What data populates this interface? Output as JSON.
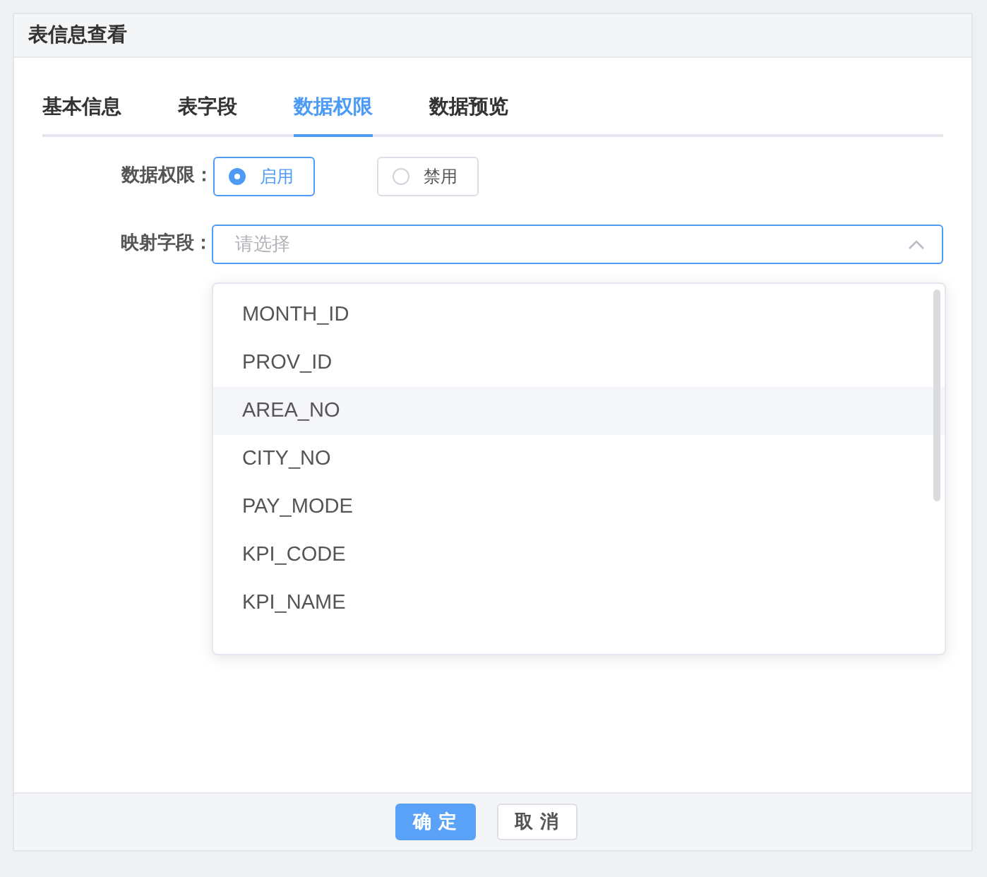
{
  "dialog": {
    "title": "表信息查看"
  },
  "tabs": [
    {
      "label": "基本信息",
      "selected": false
    },
    {
      "label": "表字段",
      "selected": false
    },
    {
      "label": "数据权限",
      "selected": true
    },
    {
      "label": "数据预览",
      "selected": false
    }
  ],
  "permission": {
    "label": "数据权限：",
    "options": [
      {
        "label": "启用",
        "selected": true
      },
      {
        "label": "禁用",
        "selected": false
      }
    ]
  },
  "mapping": {
    "label": "映射字段：",
    "placeholder": "请选择",
    "expanded": true
  },
  "dropdown": {
    "items": [
      {
        "label": "MONTH_ID",
        "hovered": false
      },
      {
        "label": "PROV_ID",
        "hovered": false
      },
      {
        "label": "AREA_NO",
        "hovered": true
      },
      {
        "label": "CITY_NO",
        "hovered": false
      },
      {
        "label": "PAY_MODE",
        "hovered": false
      },
      {
        "label": "KPI_CODE",
        "hovered": false
      },
      {
        "label": "KPI_NAME",
        "hovered": false
      }
    ]
  },
  "buttons": [
    {
      "label": "确 定",
      "kind": "primary"
    },
    {
      "label": "取 消",
      "kind": "default"
    }
  ]
}
